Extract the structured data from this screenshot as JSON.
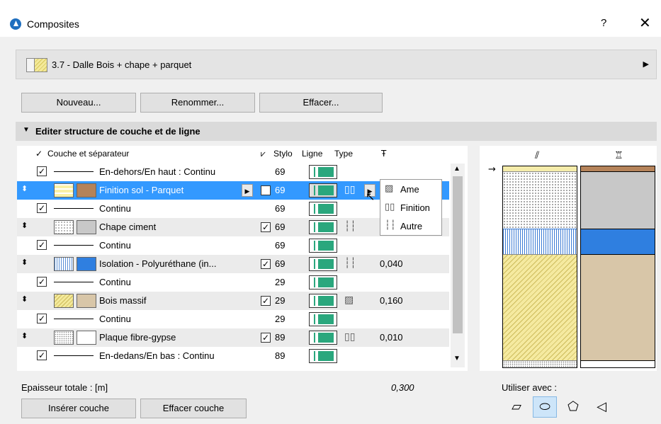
{
  "window": {
    "title": "Composites",
    "help_label": "?",
    "close_label": "✕"
  },
  "composite": {
    "selected": "3.7 - Dalle Bois + chape + parquet"
  },
  "actions": {
    "new": "Nouveau...",
    "rename": "Renommer...",
    "delete": "Effacer..."
  },
  "section": {
    "title": "Editer structure de couche et de ligne"
  },
  "columns": {
    "check": "✓",
    "layer": "Couche et séparateur",
    "pen": "Stylo",
    "line": "Ligne",
    "type": "Type",
    "thickness": "Ŧ"
  },
  "rows": [
    {
      "kind": "sep",
      "checked": "✓",
      "label": "En-dehors/En haut : Continu",
      "pen": "69"
    },
    {
      "kind": "layer",
      "selected": true,
      "label": "Finition sol - Parquet",
      "checked": "✓",
      "pen": "69",
      "type_glyph": "▯▯",
      "thickness": "",
      "fill_color": "#b5835a"
    },
    {
      "kind": "sep",
      "checked": "✓",
      "label": "Continu",
      "pen": "69"
    },
    {
      "kind": "layer",
      "label": "Chape ciment",
      "checked": "✓",
      "pen": "69",
      "type_glyph": "┆┆",
      "thickness": "",
      "fill_color": "#c8c8c8"
    },
    {
      "kind": "sep",
      "checked": "✓",
      "label": "Continu",
      "pen": "69"
    },
    {
      "kind": "layer",
      "label": "Isolation - Polyuréthane (in...",
      "checked": "✓",
      "pen": "69",
      "type_glyph": "┆┆",
      "thickness": "0,040",
      "fill_color": "#2f7fe0"
    },
    {
      "kind": "sep",
      "checked": "✓",
      "label": "Continu",
      "pen": "29"
    },
    {
      "kind": "layer",
      "label": "Bois massif",
      "checked": "✓",
      "pen": "29",
      "type_glyph": "▨",
      "thickness": "0,160",
      "fill_color": "#d8c6a8"
    },
    {
      "kind": "sep",
      "checked": "✓",
      "label": "Continu",
      "pen": "29"
    },
    {
      "kind": "layer",
      "label": "Plaque fibre-gypse",
      "checked": "✓",
      "pen": "89",
      "type_glyph": "▯▯",
      "thickness": "0,010",
      "fill_color": "#ffffff"
    },
    {
      "kind": "sep",
      "checked": "✓",
      "label": "En-dedans/En bas : Continu",
      "pen": "89"
    }
  ],
  "type_popup": [
    {
      "icon": "▨",
      "label": "Ame"
    },
    {
      "icon": "▯▯",
      "label": "Finition"
    },
    {
      "icon": "┆┆",
      "label": "Autre"
    }
  ],
  "total": {
    "label": "Epaisseur totale :  [m]",
    "value": "0,300"
  },
  "layer_buttons": {
    "insert": "Insérer couche",
    "delete": "Effacer couche"
  },
  "use_with": {
    "label": "Utiliser avec :"
  },
  "icons": {
    "app": "archicad-icon",
    "pen_fill": "#2aa77d",
    "accent": "#3399ff"
  }
}
